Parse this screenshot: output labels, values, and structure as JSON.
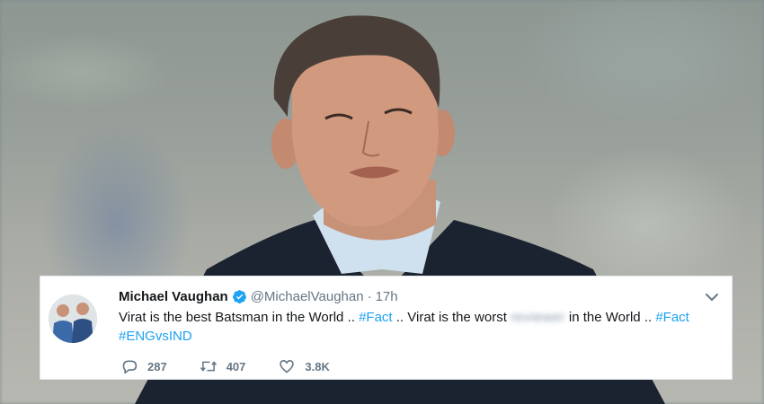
{
  "tweet": {
    "name": "Michael Vaughan",
    "handle": "@MichaelVaughan",
    "separator": "·",
    "time": "17h",
    "text_part1": "Virat is the best Batsman in the World .. ",
    "hashtag1": "#Fact",
    "text_part2": " .. Virat is the worst ",
    "blurred_word": "reviewer",
    "text_part3": " in the World .. ",
    "hashtag2": "#Fact",
    "space": " ",
    "hashtag3": "#ENGvsIND",
    "replies": "287",
    "retweets": "407",
    "likes": "3.8K"
  },
  "colors": {
    "link": "#1da1f2",
    "secondary_text": "#657786",
    "primary_text": "#14171a",
    "verified_badge": "#1da1f2"
  },
  "icons": {
    "verified": "verified-badge-icon",
    "caret": "chevron-down-icon",
    "reply": "reply-icon",
    "retweet": "retweet-icon",
    "like": "heart-icon"
  }
}
